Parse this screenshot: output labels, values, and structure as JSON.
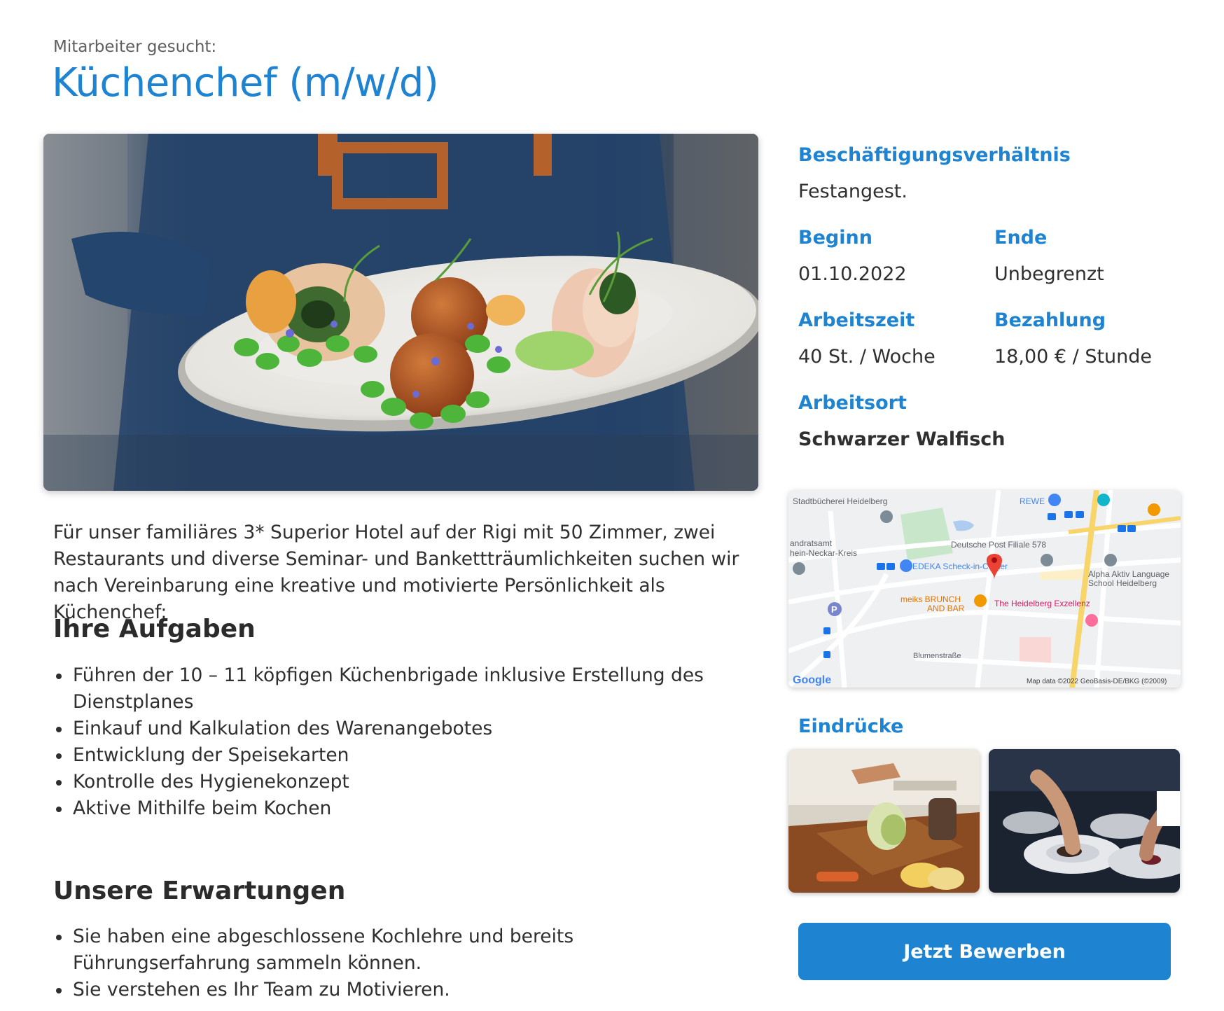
{
  "header": {
    "kicker": "Mitarbeiter gesucht:",
    "title": "Küchenchef (m/w/d)"
  },
  "intro": "Für unser familiäres 3* Superior Hotel auf der Rigi mit 50 Zimmer, zwei Restaurants und diverse Seminar- und Bankettträumlichkeiten suchen wir nach Vereinbarung eine kreative und motivierte Persönlichkeit als Küchenchef:",
  "tasks": {
    "heading": "Ihre Aufgaben",
    "items": [
      "Führen der 10 – 11 köpfigen Küchenbrigade inklusive Erstellung des Dienstplanes",
      "Einkauf und Kalkulation des Warenangebotes",
      "Entwicklung der Speisekarten",
      "Kontrolle des Hygienekonzept",
      "Aktive Mithilfe beim Kochen"
    ]
  },
  "expectations": {
    "heading": "Unsere Erwartungen",
    "items": [
      "Sie haben eine abgeschlossene Kochlehre und bereits Führungserfahrung sammeln können.",
      "Sie verstehen es Ihr Team zu Motivieren."
    ]
  },
  "details": {
    "employment": {
      "label": "Beschäftigungsverhältnis",
      "value": "Festangest."
    },
    "start": {
      "label": "Beginn",
      "value": "01.10.2022"
    },
    "end": {
      "label": "Ende",
      "value": "Unbegrenzt"
    },
    "hours": {
      "label": "Arbeitszeit",
      "value": "40 St. / Woche"
    },
    "pay": {
      "label": "Bezahlung",
      "value": "18,00 € / Stunde"
    },
    "location": {
      "label": "Arbeitsort",
      "value": "Schwarzer Walfisch"
    }
  },
  "map": {
    "labels": {
      "library": "Stadtbücherei Heidelberg",
      "rewe": "REWE",
      "landratsamt_1": "andratsamt",
      "landratsamt_2": "hein-Neckar-Kreis",
      "post": "Deutsche Post Filiale 578",
      "edeka": "EDEKA Scheck-in-Center",
      "alpha_1": "Alpha Aktiv Language",
      "alpha_2": "School Heidelberg",
      "meiks_1": "meiks BRUNCH",
      "meiks_2": "AND BAR",
      "hotel": "The Heidelberg Exzellenz",
      "street": "Blumenstraße",
      "google": "Google",
      "attribution": "Map data ©2022 GeoBasis-DE/BKG (©2009)"
    }
  },
  "impressions": {
    "heading": "Eindrücke"
  },
  "apply_button": "Jetzt Bewerben"
}
